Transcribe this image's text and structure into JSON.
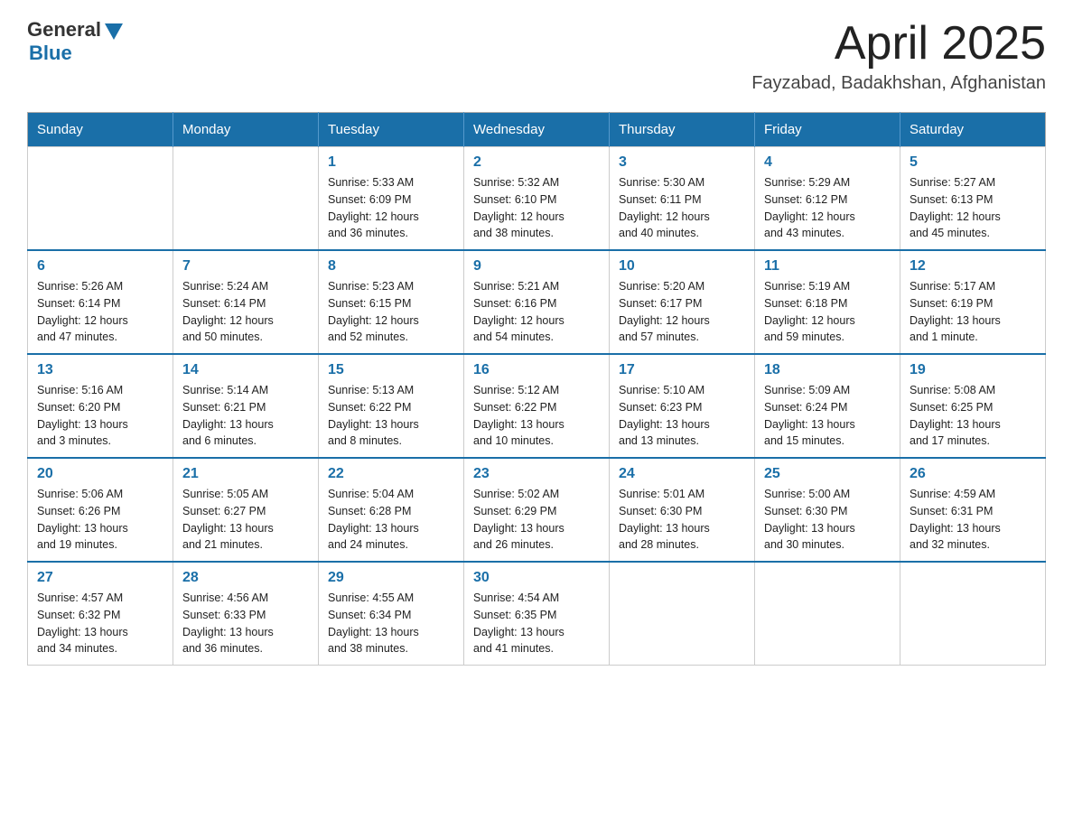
{
  "header": {
    "logo_general": "General",
    "logo_blue": "Blue",
    "month": "April 2025",
    "location": "Fayzabad, Badakhshan, Afghanistan"
  },
  "days_of_week": [
    "Sunday",
    "Monday",
    "Tuesday",
    "Wednesday",
    "Thursday",
    "Friday",
    "Saturday"
  ],
  "weeks": [
    [
      {
        "day": "",
        "info": ""
      },
      {
        "day": "",
        "info": ""
      },
      {
        "day": "1",
        "info": "Sunrise: 5:33 AM\nSunset: 6:09 PM\nDaylight: 12 hours\nand 36 minutes."
      },
      {
        "day": "2",
        "info": "Sunrise: 5:32 AM\nSunset: 6:10 PM\nDaylight: 12 hours\nand 38 minutes."
      },
      {
        "day": "3",
        "info": "Sunrise: 5:30 AM\nSunset: 6:11 PM\nDaylight: 12 hours\nand 40 minutes."
      },
      {
        "day": "4",
        "info": "Sunrise: 5:29 AM\nSunset: 6:12 PM\nDaylight: 12 hours\nand 43 minutes."
      },
      {
        "day": "5",
        "info": "Sunrise: 5:27 AM\nSunset: 6:13 PM\nDaylight: 12 hours\nand 45 minutes."
      }
    ],
    [
      {
        "day": "6",
        "info": "Sunrise: 5:26 AM\nSunset: 6:14 PM\nDaylight: 12 hours\nand 47 minutes."
      },
      {
        "day": "7",
        "info": "Sunrise: 5:24 AM\nSunset: 6:14 PM\nDaylight: 12 hours\nand 50 minutes."
      },
      {
        "day": "8",
        "info": "Sunrise: 5:23 AM\nSunset: 6:15 PM\nDaylight: 12 hours\nand 52 minutes."
      },
      {
        "day": "9",
        "info": "Sunrise: 5:21 AM\nSunset: 6:16 PM\nDaylight: 12 hours\nand 54 minutes."
      },
      {
        "day": "10",
        "info": "Sunrise: 5:20 AM\nSunset: 6:17 PM\nDaylight: 12 hours\nand 57 minutes."
      },
      {
        "day": "11",
        "info": "Sunrise: 5:19 AM\nSunset: 6:18 PM\nDaylight: 12 hours\nand 59 minutes."
      },
      {
        "day": "12",
        "info": "Sunrise: 5:17 AM\nSunset: 6:19 PM\nDaylight: 13 hours\nand 1 minute."
      }
    ],
    [
      {
        "day": "13",
        "info": "Sunrise: 5:16 AM\nSunset: 6:20 PM\nDaylight: 13 hours\nand 3 minutes."
      },
      {
        "day": "14",
        "info": "Sunrise: 5:14 AM\nSunset: 6:21 PM\nDaylight: 13 hours\nand 6 minutes."
      },
      {
        "day": "15",
        "info": "Sunrise: 5:13 AM\nSunset: 6:22 PM\nDaylight: 13 hours\nand 8 minutes."
      },
      {
        "day": "16",
        "info": "Sunrise: 5:12 AM\nSunset: 6:22 PM\nDaylight: 13 hours\nand 10 minutes."
      },
      {
        "day": "17",
        "info": "Sunrise: 5:10 AM\nSunset: 6:23 PM\nDaylight: 13 hours\nand 13 minutes."
      },
      {
        "day": "18",
        "info": "Sunrise: 5:09 AM\nSunset: 6:24 PM\nDaylight: 13 hours\nand 15 minutes."
      },
      {
        "day": "19",
        "info": "Sunrise: 5:08 AM\nSunset: 6:25 PM\nDaylight: 13 hours\nand 17 minutes."
      }
    ],
    [
      {
        "day": "20",
        "info": "Sunrise: 5:06 AM\nSunset: 6:26 PM\nDaylight: 13 hours\nand 19 minutes."
      },
      {
        "day": "21",
        "info": "Sunrise: 5:05 AM\nSunset: 6:27 PM\nDaylight: 13 hours\nand 21 minutes."
      },
      {
        "day": "22",
        "info": "Sunrise: 5:04 AM\nSunset: 6:28 PM\nDaylight: 13 hours\nand 24 minutes."
      },
      {
        "day": "23",
        "info": "Sunrise: 5:02 AM\nSunset: 6:29 PM\nDaylight: 13 hours\nand 26 minutes."
      },
      {
        "day": "24",
        "info": "Sunrise: 5:01 AM\nSunset: 6:30 PM\nDaylight: 13 hours\nand 28 minutes."
      },
      {
        "day": "25",
        "info": "Sunrise: 5:00 AM\nSunset: 6:30 PM\nDaylight: 13 hours\nand 30 minutes."
      },
      {
        "day": "26",
        "info": "Sunrise: 4:59 AM\nSunset: 6:31 PM\nDaylight: 13 hours\nand 32 minutes."
      }
    ],
    [
      {
        "day": "27",
        "info": "Sunrise: 4:57 AM\nSunset: 6:32 PM\nDaylight: 13 hours\nand 34 minutes."
      },
      {
        "day": "28",
        "info": "Sunrise: 4:56 AM\nSunset: 6:33 PM\nDaylight: 13 hours\nand 36 minutes."
      },
      {
        "day": "29",
        "info": "Sunrise: 4:55 AM\nSunset: 6:34 PM\nDaylight: 13 hours\nand 38 minutes."
      },
      {
        "day": "30",
        "info": "Sunrise: 4:54 AM\nSunset: 6:35 PM\nDaylight: 13 hours\nand 41 minutes."
      },
      {
        "day": "",
        "info": ""
      },
      {
        "day": "",
        "info": ""
      },
      {
        "day": "",
        "info": ""
      }
    ]
  ]
}
